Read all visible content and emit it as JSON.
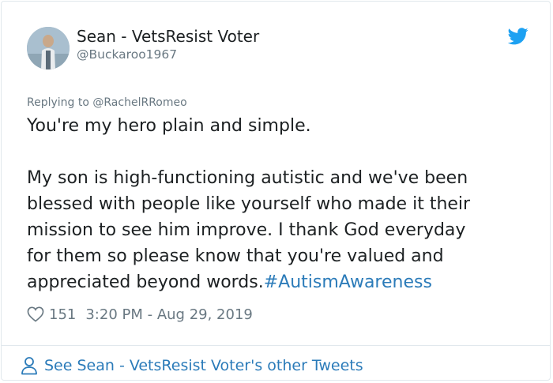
{
  "tweet": {
    "author_name": "Sean - VetsResist Voter",
    "author_handle": "@Buckaroo1967",
    "replying_prefix": "Replying to",
    "replying_to": "@RachelRRomeo",
    "line1": "You're my hero plain and simple.",
    "body_lines": [
      "My son is high-functioning autistic and we've been",
      "blessed with people like yourself who made it their",
      "mission to see him improve. I thank God everyday",
      "for them so please know that you're valued and"
    ],
    "last_line_text": "appreciated beyond words.",
    "hashtag": "#AutismAwareness",
    "like_count": "151",
    "timestamp": "3:20 PM - Aug 29, 2019"
  },
  "footer": {
    "see_more_label": "See Sean - VetsResist Voter's other Tweets"
  },
  "colors": {
    "accent": "#2b7bb9",
    "twitter_blue": "#1da1f2",
    "muted": "#697882",
    "text": "#1c2022",
    "border": "#e1e8ed"
  },
  "icons": {
    "brand": "twitter-bird-icon",
    "like": "heart-icon",
    "profile": "person-icon"
  }
}
